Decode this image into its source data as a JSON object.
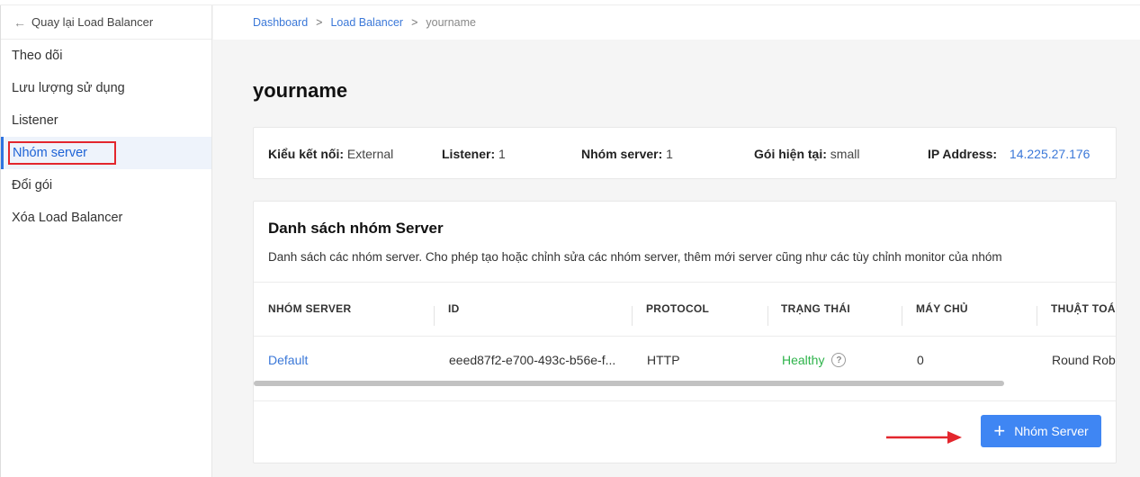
{
  "sidebar": {
    "back_label": "Quay lại Load Balancer",
    "items": [
      {
        "label": "Theo dõi"
      },
      {
        "label": "Lưu lượng sử dụng"
      },
      {
        "label": "Listener"
      },
      {
        "label": "Nhóm server"
      },
      {
        "label": "Đổi gói"
      },
      {
        "label": "Xóa Load Balancer"
      }
    ]
  },
  "breadcrumb": {
    "items": [
      "Dashboard",
      "Load Balancer",
      "yourname"
    ],
    "separator": ">"
  },
  "page": {
    "title": "yourname"
  },
  "info": {
    "connection_label": "Kiểu kết nối:",
    "connection_value": "External",
    "listener_label": "Listener:",
    "listener_value": "1",
    "group_label": "Nhóm server:",
    "group_value": "1",
    "plan_label": "Gói hiện tại:",
    "plan_value": "small",
    "ip_label": "IP Address:",
    "ip_value": "14.225.27.176"
  },
  "server_groups": {
    "title": "Danh sách nhóm Server",
    "description": "Danh sách các nhóm server. Cho phép tạo hoặc chỉnh sửa các nhóm server, thêm mới server cũng như các tùy chỉnh monitor của nhóm",
    "columns": [
      "NHÓM SERVER",
      "ID",
      "PROTOCOL",
      "TRẠNG THÁI",
      "MÁY CHỦ",
      "THUẬT TOÁN"
    ],
    "rows": [
      {
        "name": "Default",
        "id": "eeed87f2-e700-493c-b56e-f...",
        "protocol": "HTTP",
        "status": "Healthy",
        "servers": "0",
        "algorithm": "Round Robin"
      }
    ],
    "add_button_label": "Nhóm Server"
  },
  "colors": {
    "accent": "#3f86f3",
    "link": "#3b78d8",
    "healthy": "#2db34a",
    "annotation_red": "#e3262d"
  }
}
